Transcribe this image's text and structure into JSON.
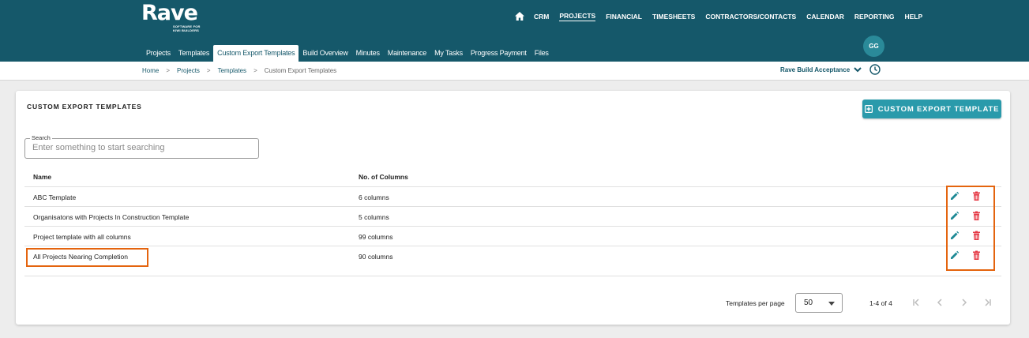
{
  "brand": {
    "name": "Rave",
    "tagline": "SOFTWARE FOR KIWI BUILDERS"
  },
  "topnav": {
    "home_icon": "home-icon",
    "items": [
      "CRM",
      "PROJECTS",
      "FINANCIAL",
      "TIMESHEETS",
      "CONTRACTORS/CONTACTS",
      "CALENDAR",
      "REPORTING",
      "HELP"
    ],
    "active": "PROJECTS"
  },
  "user": {
    "initials": "GG"
  },
  "subnav": {
    "items": [
      "Projects",
      "Templates",
      "Custom Export Templates",
      "Build Overview",
      "Minutes",
      "Maintenance",
      "My Tasks",
      "Progress Payment",
      "Files"
    ],
    "active": "Custom Export Templates"
  },
  "breadcrumb": {
    "items": [
      "Home",
      "Projects",
      "Templates"
    ],
    "current": "Custom Export Templates",
    "separator": ">"
  },
  "project_selector": {
    "value": "Rave Build Acceptance"
  },
  "page": {
    "title": "CUSTOM EXPORT TEMPLATES",
    "add_button": "CUSTOM EXPORT TEMPLATE",
    "search": {
      "label": "Search",
      "placeholder": "Enter something to start searching",
      "value": ""
    }
  },
  "table": {
    "headers": [
      "Name",
      "No. of Columns"
    ],
    "rows": [
      {
        "name": "ABC Template",
        "columns": "6 columns"
      },
      {
        "name": "Organisatons with Projects In Construction Template",
        "columns": "5 columns"
      },
      {
        "name": "Project template with all columns",
        "columns": "99 columns"
      },
      {
        "name": "All Projects Nearing Completion",
        "columns": "90 columns"
      }
    ]
  },
  "pagination": {
    "per_page_label": "Templates per page",
    "per_page": "50",
    "range": "1-4 of 4"
  },
  "colors": {
    "header_bg": "#15586a",
    "accent": "#2a9aab",
    "edit": "#1f8a96",
    "delete": "#e53945",
    "highlight": "#e4640e"
  }
}
